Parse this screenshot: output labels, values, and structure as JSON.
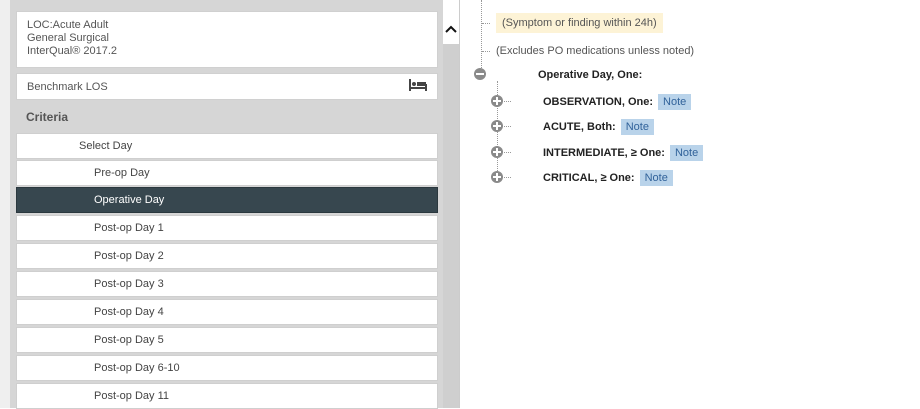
{
  "header": {
    "line1": "LOC:Acute Adult",
    "line2": "General Surgical",
    "line3": "InterQual® 2017.2"
  },
  "benchmark": {
    "label": "Benchmark LOS",
    "icon": "bed-icon"
  },
  "criteria": {
    "label": "Criteria"
  },
  "days": {
    "select_label": "Select Day",
    "items": [
      {
        "label": "Pre-op Day"
      },
      {
        "label": "Operative Day",
        "active": true
      },
      {
        "label": "Post-op Day 1"
      },
      {
        "label": "Post-op Day 2"
      },
      {
        "label": "Post-op Day 3"
      },
      {
        "label": "Post-op Day 4"
      },
      {
        "label": "Post-op Day 5"
      },
      {
        "label": "Post-op Day 6-10"
      },
      {
        "label": "Post-op Day 11"
      }
    ]
  },
  "tree": {
    "symptom_note": "(Symptom or finding within 24h)",
    "excludes_note": "(Excludes PO medications unless noted)",
    "root": {
      "label": "Operative Day, One:"
    },
    "children": [
      {
        "label": "OBSERVATION, One:",
        "note": "Note"
      },
      {
        "label": "ACUTE, Both:",
        "note": "Note"
      },
      {
        "label": "INTERMEDIATE, ≥ One:",
        "note": "Note"
      },
      {
        "label": "CRITICAL, ≥ One:",
        "note": "Note"
      }
    ]
  },
  "colors": {
    "active_row": "#37474f",
    "note_bg": "#b9d3ea",
    "note_text": "#31629a",
    "symptom_bg": "#fdf3d6"
  }
}
